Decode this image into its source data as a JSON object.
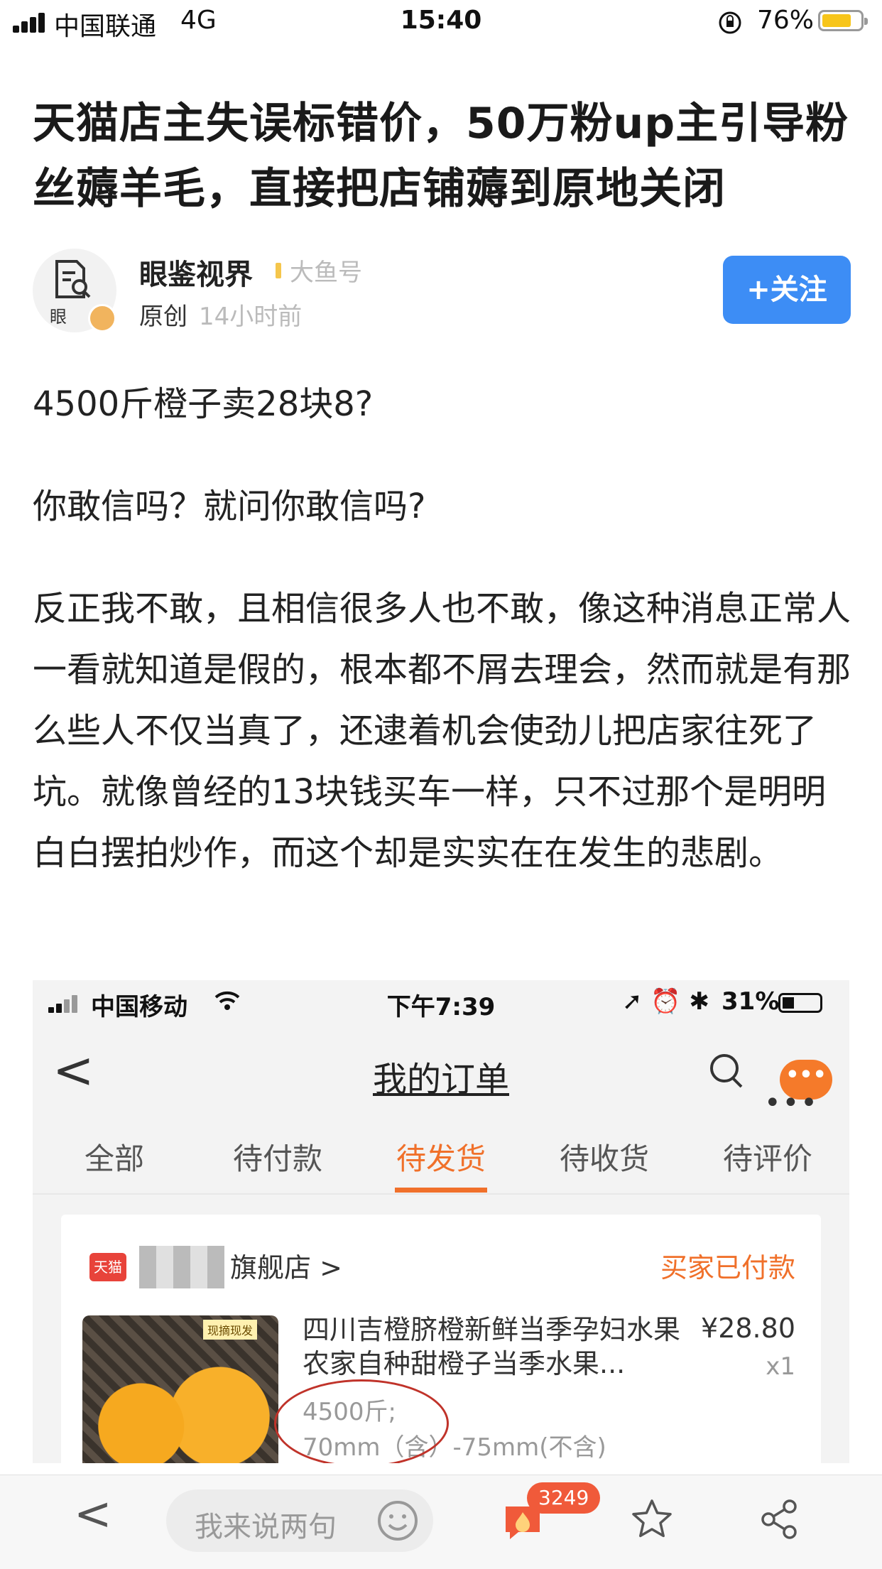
{
  "status_bar": {
    "carrier": "中国联通",
    "network": "4G",
    "time": "15:40",
    "battery": "76%"
  },
  "article": {
    "title": "天猫店主失误标错价，50万粉up主引导粉丝薅羊毛，直接把店铺薅到原地关闭",
    "author": {
      "avatar_char": "眼",
      "name": "眼鉴视界",
      "source": "大鱼号",
      "original_label": "原创",
      "time_ago": "14小时前"
    },
    "follow_label": "+关注",
    "paragraphs": [
      "4500斤橙子卖28块8?",
      "你敢信吗？就问你敢信吗?",
      "反正我不敢，且相信很多人也不敢，像这种消息正常人一看就知道是假的，根本都不屑去理会，然而就是有那么些人不仅当真了，还逮着机会使劲儿把店家往死了坑。就像曾经的13块钱买车一样，只不过那个是明明白白摆拍炒作，而这个却是实实在在发生的悲剧。"
    ]
  },
  "embedded_screenshot": {
    "status_bar": {
      "carrier": "中国移动",
      "time": "下午7:39",
      "icons": "➚ ⏰ ✱",
      "battery": "31%"
    },
    "header": {
      "back": "<",
      "title": "我的订单",
      "more": "•••",
      "bubble": "•••"
    },
    "tabs": [
      {
        "label": "全部",
        "active": false
      },
      {
        "label": "待付款",
        "active": false
      },
      {
        "label": "待发货",
        "active": true
      },
      {
        "label": "待收货",
        "active": false
      },
      {
        "label": "待评价",
        "active": false
      }
    ],
    "order": {
      "tmall_logo": "天猫",
      "shop_name": "旗舰店 >",
      "status": "买家已付款",
      "image_tag": "现摘现发",
      "product_name": "四川吉橙脐橙新鲜当季孕妇水果农家自种甜橙子当季水果...",
      "price": "¥28.80",
      "quantity": "x1",
      "spec_weight": "4500斤;",
      "spec_size": "70mm（含）-75mm(不含)"
    }
  },
  "bottom_bar": {
    "back": "<",
    "comment_placeholder": "我来说两句",
    "comment_count": "3249"
  },
  "colors": {
    "follow_button": "#3d8df5",
    "accent_orange": "#f0702a",
    "badge_red": "#f05a3a",
    "battery_yellow": "#f7c51a"
  }
}
